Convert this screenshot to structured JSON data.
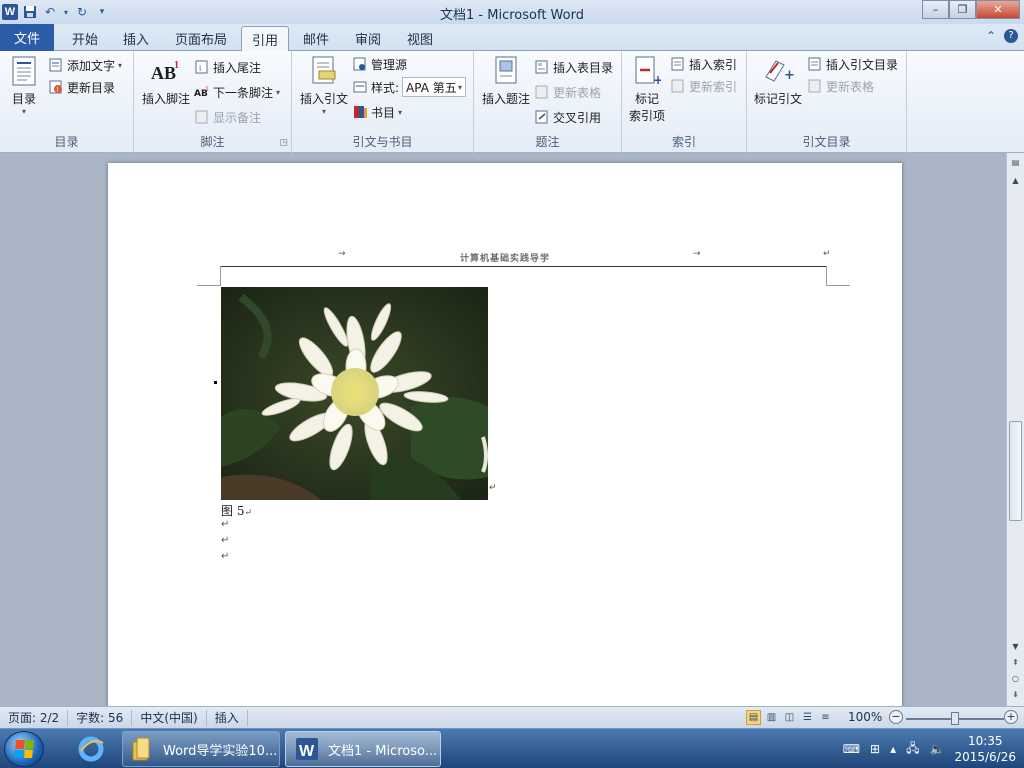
{
  "window": {
    "title": "文档1 - Microsoft Word",
    "app_icon_letter": "W",
    "minimize": "–",
    "maximize": "❐",
    "close": "✕"
  },
  "tabs": [
    {
      "label": "文件"
    },
    {
      "label": "开始"
    },
    {
      "label": "插入"
    },
    {
      "label": "页面布局"
    },
    {
      "label": "引用"
    },
    {
      "label": "邮件"
    },
    {
      "label": "审阅"
    },
    {
      "label": "视图"
    }
  ],
  "ribbon": {
    "toc": {
      "label": "目录",
      "big": "目录",
      "add_text": "添加文字",
      "update": "更新目录"
    },
    "footnotes": {
      "label": "脚注",
      "insert_footnote": "插入脚注",
      "insert_endnote": "插入尾注",
      "next_footnote": "下一条脚注",
      "show_notes": "显示备注"
    },
    "citations": {
      "label": "引文与书目",
      "insert_citation": "插入引文",
      "manage_sources": "管理源",
      "style_label": "样式:",
      "style_value": "APA 第五",
      "bibliography": "书目"
    },
    "captions": {
      "label": "题注",
      "insert_caption": "插入题注",
      "insert_table_of_figures": "插入表目录",
      "update_table": "更新表格",
      "cross_reference": "交叉引用"
    },
    "index": {
      "label": "索引",
      "mark_entry_line1": "标记",
      "mark_entry_line2": "索引项",
      "insert_index": "插入索引",
      "update_index": "更新索引"
    },
    "toa": {
      "label": "引文目录",
      "mark_citation": "标记引文",
      "insert_toa": "插入引文目录",
      "update_table": "更新表格"
    }
  },
  "document": {
    "header_text": "计算机基础实践导学",
    "caption": "图 5",
    "paragraph_mark": "↵",
    "tab_mark": "→"
  },
  "statusbar": {
    "page": "页面: 2/2",
    "words": "字数: 56",
    "language": "中文(中国)",
    "mode": "插入",
    "zoom": "100%"
  },
  "taskbar": {
    "items": [
      {
        "label": "Word导学实验10..."
      },
      {
        "label": "文档1 - Microso..."
      }
    ],
    "time": "10:35",
    "date": "2015/6/26"
  },
  "colors": {
    "accent": "#2a5ca8",
    "ribbon_bg": "#e4ecf7",
    "taskbar": "#1e467a"
  }
}
